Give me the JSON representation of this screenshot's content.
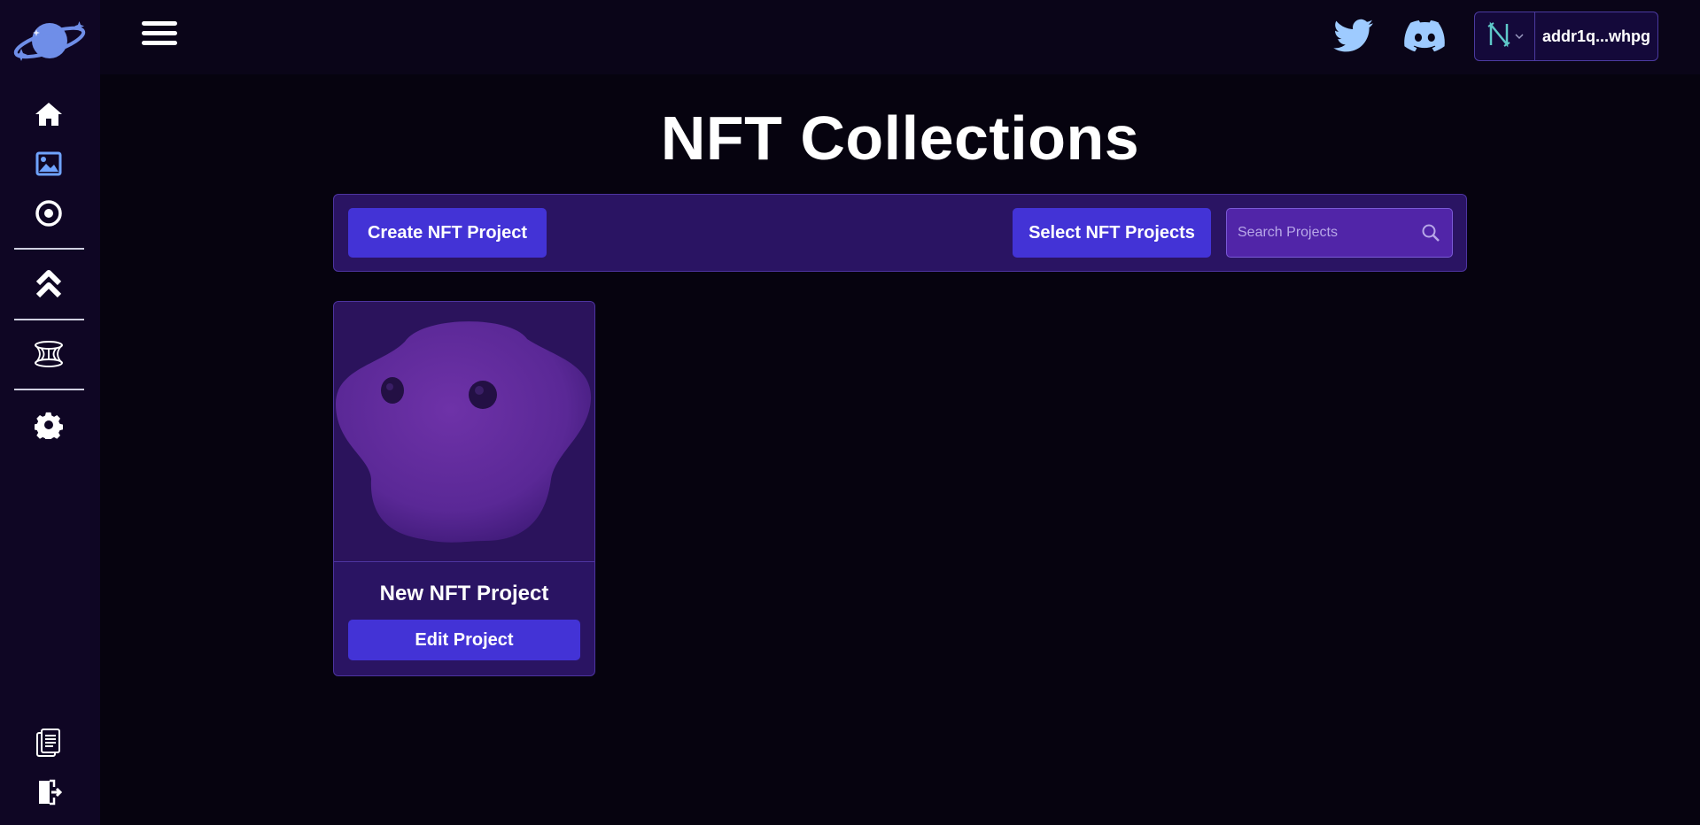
{
  "sidebar": {
    "items": [
      {
        "icon": "home-icon"
      },
      {
        "icon": "image-icon"
      },
      {
        "icon": "target-icon"
      },
      {
        "icon": "double-chevron-up-icon"
      },
      {
        "icon": "wormhole-icon"
      },
      {
        "icon": "gear-icon"
      },
      {
        "icon": "documents-icon"
      },
      {
        "icon": "logout-icon"
      }
    ]
  },
  "header": {
    "wallet_address": "addr1q...whpg",
    "social": [
      "twitter-icon",
      "discord-icon"
    ]
  },
  "page": {
    "title": "NFT Collections"
  },
  "toolbar": {
    "create_label": "Create NFT Project",
    "select_label": "Select NFT Projects",
    "search_placeholder": "Search Projects"
  },
  "projects": [
    {
      "name": "New NFT Project",
      "edit_label": "Edit Project"
    }
  ],
  "colors": {
    "background": "#06030f",
    "sidebar": "#0f0624",
    "accent": "#4333d6",
    "panel": "#2a1463",
    "icon_blue": "#9ecbff"
  }
}
